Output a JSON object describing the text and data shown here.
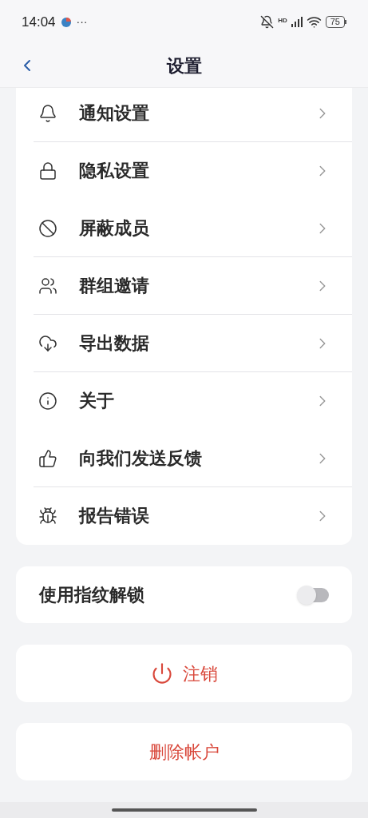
{
  "status_bar": {
    "time": "14:04",
    "more": "···",
    "network": "HD",
    "battery": "75"
  },
  "header": {
    "title": "设置"
  },
  "menu": [
    {
      "kind": "bell",
      "label": "通知设置",
      "divider_below": true
    },
    {
      "kind": "lock",
      "label": "隐私设置",
      "divider_below": false
    },
    {
      "kind": "block",
      "label": "屏蔽成员",
      "divider_below": true
    },
    {
      "kind": "group",
      "label": "群组邀请",
      "divider_below": true
    },
    {
      "kind": "cloud",
      "label": "导出数据",
      "divider_below": true
    },
    {
      "kind": "info",
      "label": "关于",
      "divider_below": false
    },
    {
      "kind": "thumb",
      "label": "向我们发送反馈",
      "divider_below": true
    },
    {
      "kind": "bug",
      "label": "报告错误",
      "divider_below": false
    }
  ],
  "fingerprint": {
    "label": "使用指纹解锁",
    "on": false
  },
  "logout": {
    "label": "注销"
  },
  "delete_account": {
    "label": "删除帐户"
  }
}
